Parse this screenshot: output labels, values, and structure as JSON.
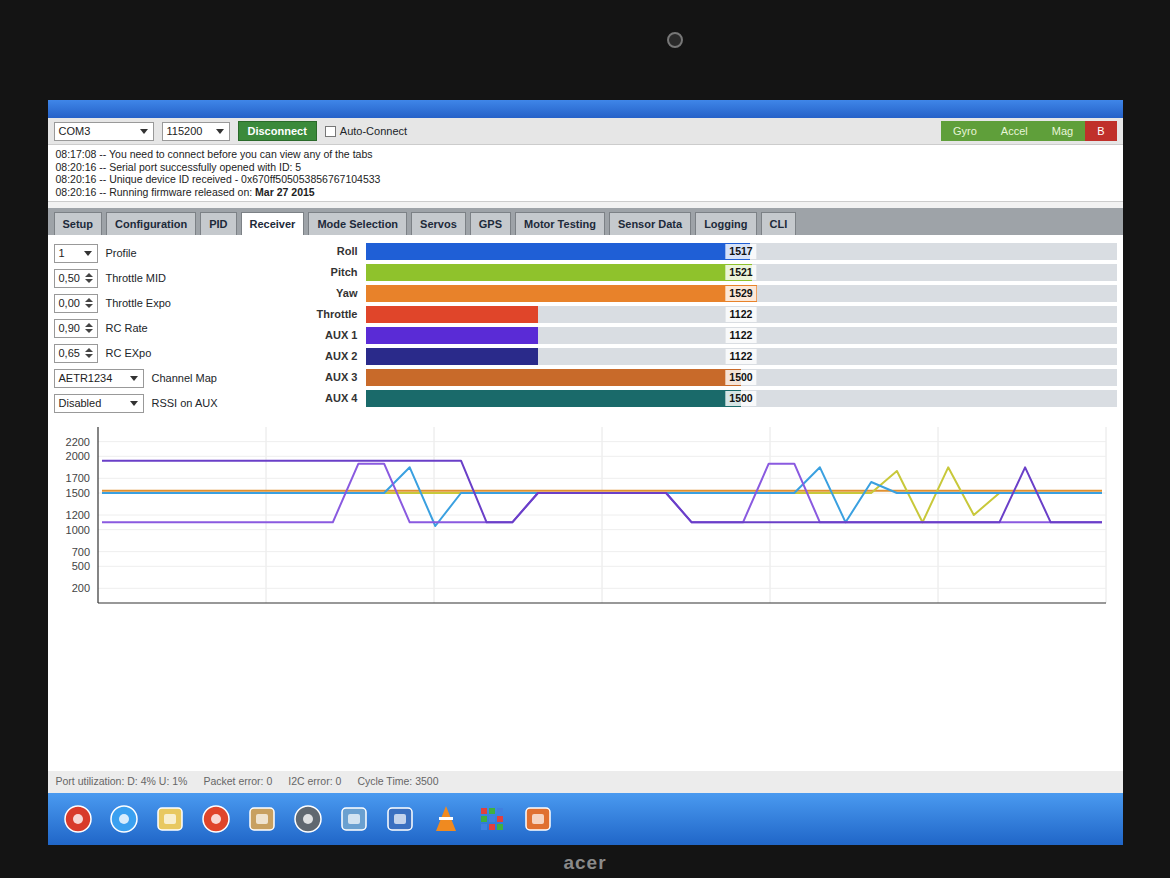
{
  "top_bar": {
    "port": "COM3",
    "baud": "115200",
    "connect_button": "Disconnect",
    "auto_connect": {
      "label": "Auto-Connect",
      "checked": false
    }
  },
  "sensors": [
    {
      "label": "Gyro",
      "detected": true
    },
    {
      "label": "Accel",
      "detected": true
    },
    {
      "label": "Mag",
      "detected": true
    },
    {
      "label": "B",
      "detected": false
    }
  ],
  "log": [
    {
      "text": "08:17:08 -- You need to connect before you can view any of the tabs",
      "strong": ""
    },
    {
      "text": "08:20:16 -- Serial port successfully opened with ID: 5",
      "strong": ""
    },
    {
      "text": "08:20:16 -- Unique device ID received - 0x670ff505053856767104533",
      "strong": ""
    },
    {
      "text": "08:20:16 -- Running firmware released on: ",
      "strong": "Mar 27 2015"
    }
  ],
  "tabs": [
    {
      "label": "Setup",
      "selected": false
    },
    {
      "label": "Configuration",
      "selected": false
    },
    {
      "label": "PID",
      "selected": false
    },
    {
      "label": "Receiver",
      "selected": true
    },
    {
      "label": "Mode Selection",
      "selected": false
    },
    {
      "label": "Servos",
      "selected": false
    },
    {
      "label": "GPS",
      "selected": false
    },
    {
      "label": "Motor Testing",
      "selected": false
    },
    {
      "label": "Sensor Data",
      "selected": false
    },
    {
      "label": "Logging",
      "selected": false
    },
    {
      "label": "CLI",
      "selected": false
    }
  ],
  "settings": [
    {
      "kind": "select",
      "value": "1",
      "label": "Profile"
    },
    {
      "kind": "number",
      "value": "0,50",
      "label": "Throttle MID"
    },
    {
      "kind": "number",
      "value": "0,00",
      "label": "Throttle Expo"
    },
    {
      "kind": "number",
      "value": "0,90",
      "label": "RC Rate"
    },
    {
      "kind": "number",
      "value": "0,65",
      "label": "RC EXpo"
    },
    {
      "kind": "select",
      "value": "AETR1234",
      "label": "Channel Map"
    },
    {
      "kind": "select",
      "value": "Disabled",
      "label": "RSSI on AUX"
    }
  ],
  "channels": [
    {
      "name": "Roll",
      "reading": "1517",
      "level": 0.512,
      "color": "#1f5fd6"
    },
    {
      "name": "Pitch",
      "reading": "1521",
      "level": 0.515,
      "color": "#8fc22c"
    },
    {
      "name": "Yaw",
      "reading": "1529",
      "level": 0.521,
      "color": "#e8822a"
    },
    {
      "name": "Throttle",
      "reading": "1122",
      "level": 0.23,
      "color": "#e0452a"
    },
    {
      "name": "AUX 1",
      "reading": "1122",
      "level": 0.23,
      "color": "#5a2bd6"
    },
    {
      "name": "AUX 2",
      "reading": "1122",
      "level": 0.23,
      "color": "#2a2a8a"
    },
    {
      "name": "AUX 3",
      "reading": "1500",
      "level": 0.5,
      "color": "#c86a2a"
    },
    {
      "name": "AUX 4",
      "reading": "1500",
      "level": 0.5,
      "color": "#1a6a6a"
    }
  ],
  "chart": {
    "y_ticks": [
      "2200",
      "2000",
      "1700",
      "1500",
      "1200",
      "1000",
      "700",
      "500",
      "200"
    ],
    "series": [
      {
        "color": "#e09030",
        "values": [
          1530,
          1530,
          1530,
          1530,
          1530,
          1530,
          1530,
          1530,
          1530,
          1530,
          1530,
          1530,
          1530,
          1530,
          1530,
          1530,
          1530,
          1530,
          1530,
          1530,
          1530,
          1530,
          1530,
          1530,
          1530,
          1530,
          1530,
          1530,
          1530,
          1530,
          1530,
          1530,
          1530,
          1530,
          1530,
          1530,
          1530,
          1530,
          1530,
          1530
        ]
      },
      {
        "color": "#c8c83a",
        "values": [
          1500,
          1500,
          1500,
          1500,
          1500,
          1500,
          1500,
          1500,
          1500,
          1500,
          1500,
          1500,
          1500,
          1500,
          1500,
          1500,
          1500,
          1500,
          1500,
          1500,
          1500,
          1500,
          1500,
          1500,
          1500,
          1500,
          1500,
          1500,
          1500,
          1500,
          1500,
          1800,
          1100,
          1850,
          1200,
          1500,
          1500,
          1500,
          1500,
          1500
        ]
      },
      {
        "color": "#3aa0e0",
        "values": [
          1500,
          1500,
          1500,
          1500,
          1500,
          1500,
          1500,
          1500,
          1500,
          1500,
          1500,
          1500,
          1850,
          1050,
          1500,
          1500,
          1500,
          1500,
          1500,
          1500,
          1500,
          1500,
          1500,
          1500,
          1500,
          1500,
          1500,
          1500,
          1850,
          1100,
          1650,
          1500,
          1500,
          1500,
          1500,
          1500,
          1500,
          1500,
          1500,
          1500
        ]
      },
      {
        "color": "#8a5ae0",
        "values": [
          1100,
          1100,
          1100,
          1100,
          1100,
          1100,
          1100,
          1100,
          1100,
          1100,
          1900,
          1900,
          1100,
          1100,
          1100,
          1100,
          1100,
          1500,
          1500,
          1500,
          1500,
          1500,
          1500,
          1100,
          1100,
          1100,
          1900,
          1900,
          1100,
          1100,
          1100,
          1100,
          1100,
          1100,
          1100,
          1100,
          1100,
          1100,
          1100,
          1100
        ]
      },
      {
        "color": "#6a3fc8",
        "values": [
          1940,
          1940,
          1940,
          1940,
          1940,
          1940,
          1940,
          1940,
          1940,
          1940,
          1940,
          1940,
          1940,
          1940,
          1940,
          1100,
          1100,
          1500,
          1500,
          1500,
          1500,
          1500,
          1500,
          1100,
          1100,
          1100,
          1100,
          1100,
          1100,
          1100,
          1100,
          1100,
          1100,
          1100,
          1100,
          1100,
          1850,
          1100,
          1100,
          1100
        ]
      }
    ]
  },
  "status_bar": [
    "Port utilization: D: 4% U: 1%",
    "Packet error: 0",
    "I2C error: 0",
    "Cycle Time: 3500"
  ],
  "bezel_logo": "acer"
}
